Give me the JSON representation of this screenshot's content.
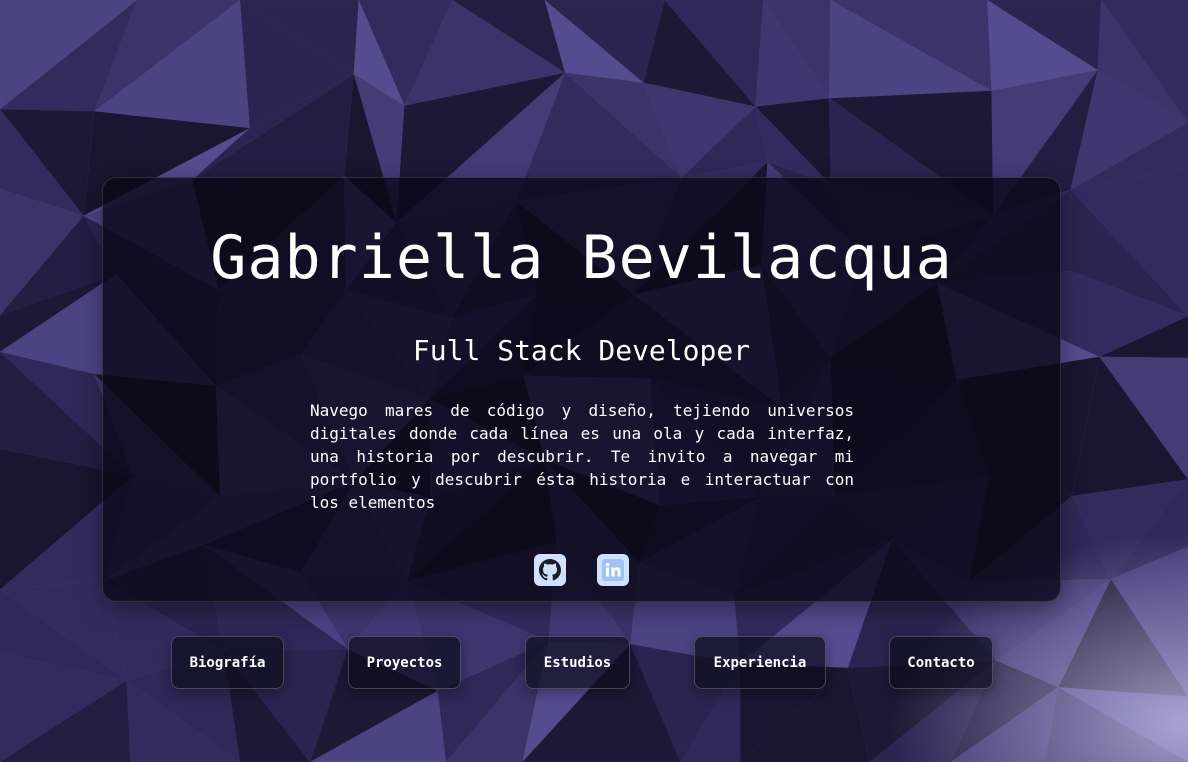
{
  "profile": {
    "name": "Gabriella Bevilacqua",
    "role": "Full Stack Developer",
    "bio": "Navego mares de código y diseño, tejiendo universos digitales donde cada línea es una ola y cada interfaz, una historia por descubrir. Te invito a navegar mi portfolio y descubrir ésta historia e interactuar con los elementos"
  },
  "social": [
    {
      "icon": "github-icon"
    },
    {
      "icon": "linkedin-icon"
    }
  ],
  "nav": {
    "biografia": "Biografía",
    "proyectos": "Proyectos",
    "estudios": "Estudios",
    "experiencia": "Experiencia",
    "contacto": "Contacto"
  },
  "colors": {
    "background": "#3c3470",
    "card": "#0a0818",
    "text": "#ffffff",
    "social_bg": "#cfe1ff"
  }
}
